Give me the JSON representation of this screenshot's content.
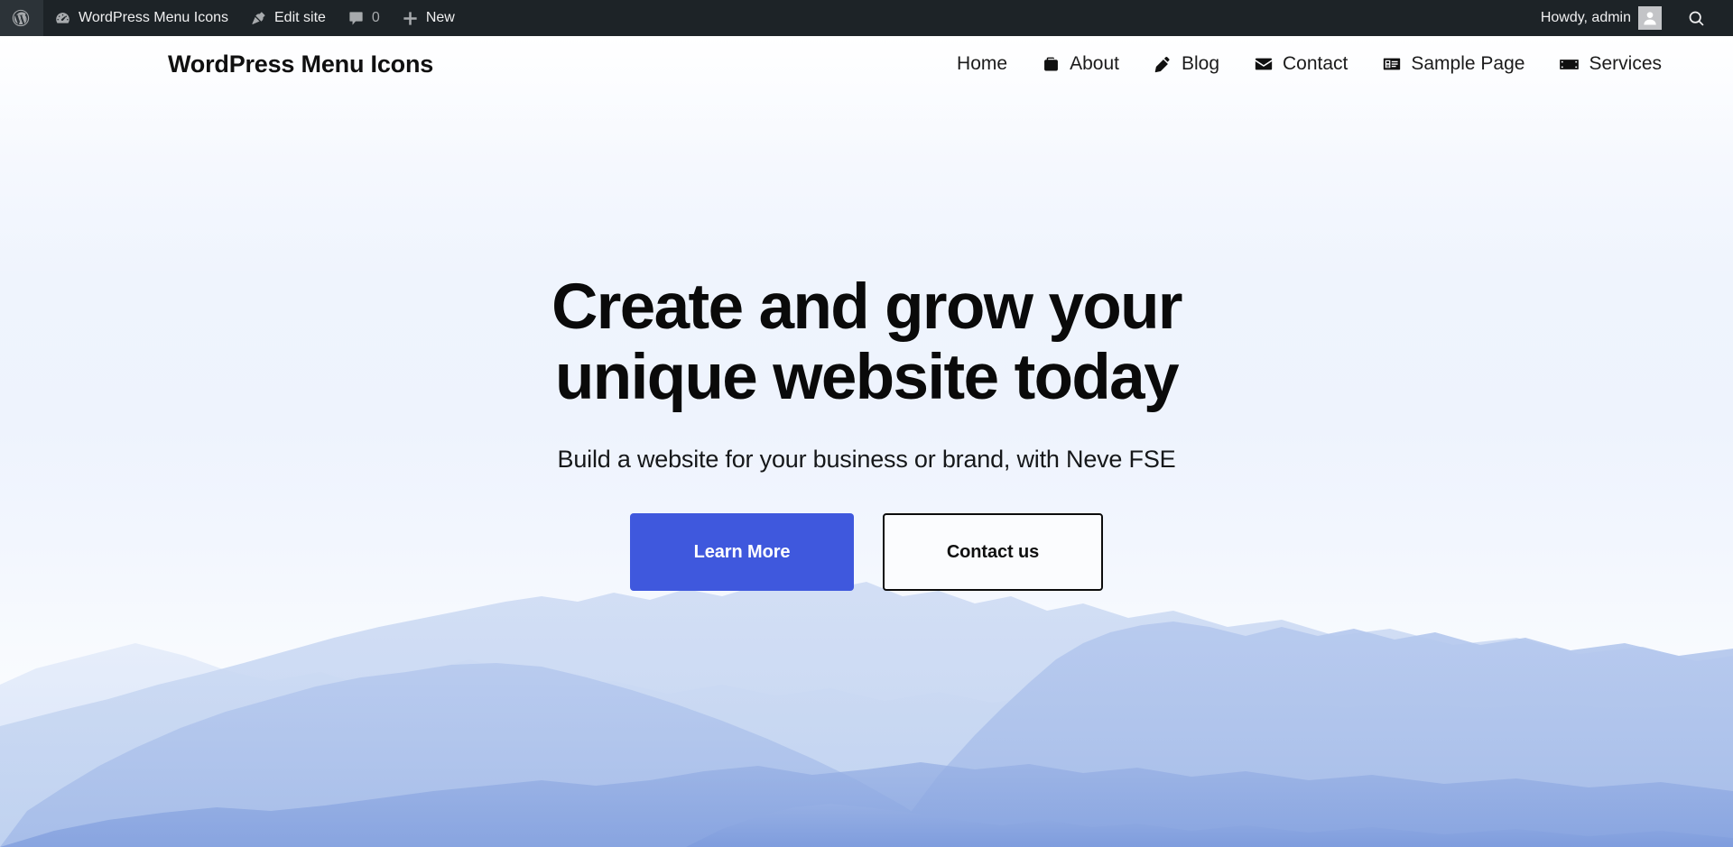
{
  "admin_bar": {
    "wp_logo_icon": "wordpress-logo-icon",
    "items": [
      {
        "label": "WordPress Menu Icons",
        "icon": "dashboard-icon",
        "name": "site-name-menu"
      },
      {
        "label": "Edit site",
        "icon": "pushpin-icon",
        "name": "edit-site-menu"
      },
      {
        "label": "0",
        "icon": "comment-bubble-icon",
        "name": "comments-menu"
      },
      {
        "label": "New",
        "icon": "plus-icon",
        "name": "new-content-menu"
      }
    ],
    "howdy": "Howdy, admin",
    "avatar_icon": "user-avatar-icon",
    "search_icon": "search-icon"
  },
  "header": {
    "site_title": "WordPress Menu Icons",
    "nav": [
      {
        "label": "Home",
        "icon": null
      },
      {
        "label": "About",
        "icon": "briefcase-icon"
      },
      {
        "label": "Blog",
        "icon": "pencil-icon"
      },
      {
        "label": "Contact",
        "icon": "envelope-icon"
      },
      {
        "label": "Sample Page",
        "icon": "id-card-icon"
      },
      {
        "label": "Services",
        "icon": "banknote-icon"
      }
    ]
  },
  "hero": {
    "title_line1": "Create and grow your",
    "title_line2": "unique website today",
    "subtitle": "Build a website for your business or brand, with Neve FSE",
    "primary_button": "Learn More",
    "secondary_button": "Contact us",
    "background_art": "blue-mountain-landscape"
  },
  "colors": {
    "admin_bar_bg": "#1d2327",
    "primary_button_bg": "#3f58dd",
    "hero_bg_top": "#ffffff",
    "hero_bg_mid": "#eef3fd",
    "text": "#0a0a0a",
    "mountain_far": "#dbe5f8",
    "mountain_mid": "#c3d3f1",
    "mountain_near": "#a9bfea",
    "mountain_dark": "#8aa6e0"
  }
}
